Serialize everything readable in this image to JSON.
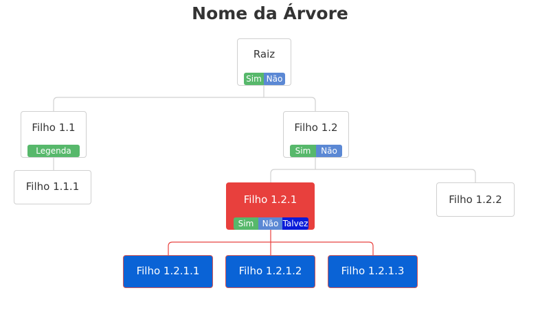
{
  "title": "Nome da Árvore",
  "colors": {
    "edge": "#d0d0d0",
    "edge_active": "#e8403d",
    "badge_green": "#57b86b",
    "badge_blue": "#5b88d4",
    "badge_darkblue": "#0a1bd9",
    "node_red": "#e8403d",
    "node_blue": "#0a63d6"
  },
  "nodes": {
    "root": {
      "label": "Raiz",
      "badges": [
        "Sim",
        "Não"
      ]
    },
    "n11": {
      "label": "Filho 1.1",
      "badges": [
        "Legenda"
      ]
    },
    "n111": {
      "label": "Filho 1.1.1"
    },
    "n12": {
      "label": "Filho 1.2",
      "badges": [
        "Sim",
        "Não"
      ]
    },
    "n121": {
      "label": "Filho 1.2.1",
      "badges": [
        "Sim",
        "Não",
        "Talvez"
      ]
    },
    "n122": {
      "label": "Filho 1.2.2"
    },
    "n1211": {
      "label": "Filho 1.2.1.1"
    },
    "n1212": {
      "label": "Filho 1.2.1.2"
    },
    "n1213": {
      "label": "Filho 1.2.1.3"
    }
  }
}
